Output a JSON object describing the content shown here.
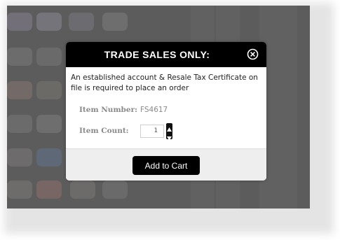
{
  "modal": {
    "title": "TRADE SALES ONLY:",
    "close_icon": "close-circle-icon",
    "notice": "An established account & Resale Tax Certificate on file is required to place an order",
    "item_number": {
      "label": "Item Number:",
      "value": "FS4617"
    },
    "item_count": {
      "label": "Item Count:",
      "value": "1"
    },
    "add_to_cart_label": "Add to Cart"
  },
  "colors": {
    "header_bg": "#000000",
    "overlay": "#5c5c5c",
    "footer_bg": "#eeeeee"
  }
}
